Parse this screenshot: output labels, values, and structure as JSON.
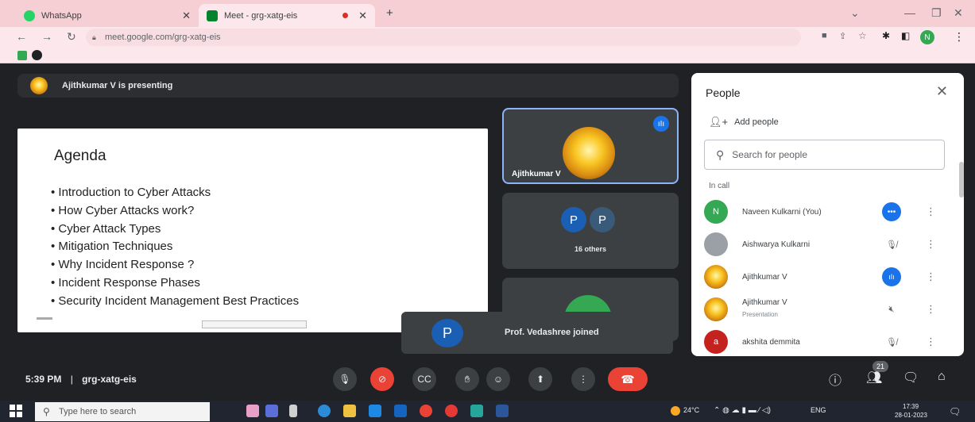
{
  "browser": {
    "tabs": [
      {
        "label": "WhatsApp",
        "active": false
      },
      {
        "label": "Meet - grg-xatg-eis",
        "active": true
      }
    ],
    "url": "meet.google.com/grg-xatg-eis",
    "profile_initial": "N"
  },
  "meet": {
    "presenting_banner": "Ajithkumar V is presenting",
    "slide": {
      "title": "Agenda",
      "bullets": [
        "Introduction to Cyber Attacks",
        "How Cyber Attacks work?",
        "Cyber Attack Types",
        "Mitigation Techniques",
        "Why Incident Response ?",
        "Incident Response Phases",
        "Security Incident Management Best Practices"
      ]
    },
    "tiles": {
      "speaker_name": "Ajithkumar V",
      "others_label": "16 others",
      "others_initials": [
        "P",
        "P"
      ]
    },
    "toast": {
      "initial": "P",
      "text": "Prof. Vedashree joined"
    },
    "bottom": {
      "time": "5:39 PM",
      "separator": "|",
      "meeting_code": "grg-xatg-eis",
      "participant_count": "21"
    }
  },
  "people_panel": {
    "title": "People",
    "add_people": "Add people",
    "search_placeholder": "Search for people",
    "section_label": "In call",
    "participants": [
      {
        "initial": "N",
        "name": "Naveen Kulkarni (You)",
        "sub": "",
        "status": "speaking-dots",
        "avatar_color": "#34a853"
      },
      {
        "initial": "",
        "name": "Aishwarya Kulkarni",
        "sub": "",
        "status": "muted",
        "avatar_color": "#9aa0a6"
      },
      {
        "initial": "",
        "name": "Ajithkumar V",
        "sub": "",
        "status": "speaking",
        "avatar_color": "#f9c623"
      },
      {
        "initial": "",
        "name": "Ajithkumar V",
        "sub": "Presentation",
        "status": "muted-presentation",
        "avatar_color": "#f9c623"
      },
      {
        "initial": "a",
        "name": "akshita demmita",
        "sub": "",
        "status": "muted",
        "avatar_color": "#c5221f"
      }
    ]
  },
  "taskbar": {
    "search_placeholder": "Type here to search",
    "weather": "24°C",
    "language": "ENG",
    "time": "17:39",
    "date": "28-01-2023"
  }
}
